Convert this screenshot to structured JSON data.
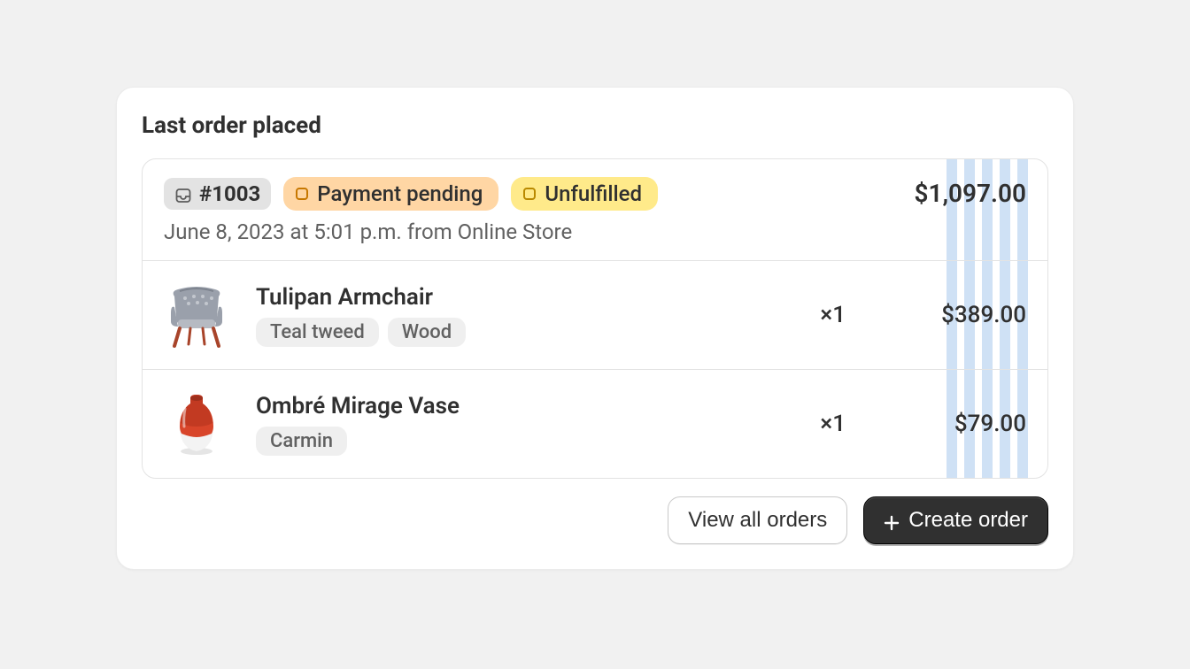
{
  "card": {
    "title": "Last order placed",
    "order": {
      "id": "#1003",
      "payment_status": "Payment pending",
      "fulfillment_status": "Unfulfilled",
      "meta": "June 8, 2023 at 5:01 p.m. from Online Store",
      "total": "$1,097.00"
    },
    "items": [
      {
        "name": "Tulipan Armchair",
        "variants": [
          "Teal tweed",
          "Wood"
        ],
        "qty": "×1",
        "price": "$389.00"
      },
      {
        "name": "Ombré Mirage Vase",
        "variants": [
          "Carmin"
        ],
        "qty": "×1",
        "price": "$79.00"
      }
    ],
    "actions": {
      "view_all": "View all orders",
      "create": "Create order"
    }
  }
}
